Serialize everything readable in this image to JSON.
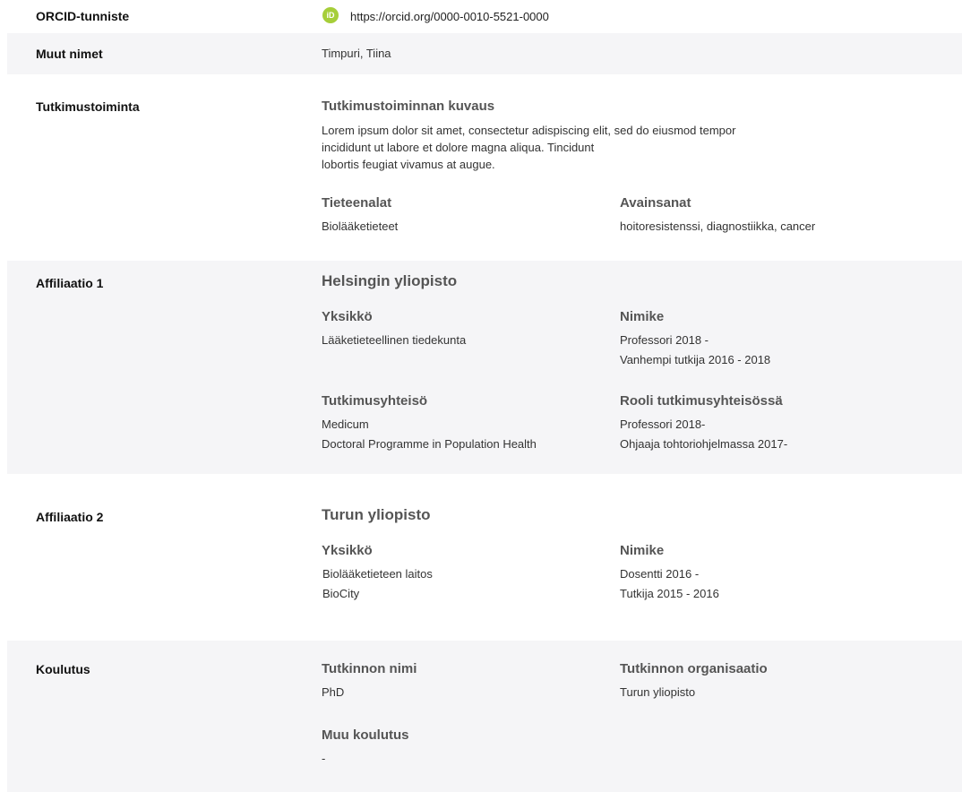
{
  "orcid": {
    "label": "ORCID-tunniste",
    "icon": "orcid-icon",
    "icon_text": "iD",
    "url": "https://orcid.org/0000-0010-5521-0000"
  },
  "other_names": {
    "label": "Muut nimet",
    "value": "Timpuri, Tiina"
  },
  "research": {
    "label": "Tutkimustoiminta",
    "desc_heading": "Tutkimustoiminnan kuvaus",
    "desc_lines": [
      "Lorem ipsum dolor sit amet, consectetur adispiscing elit, sed do eiusmod tempor",
      "incididunt ut labore et dolore magna aliqua. Tincidunt",
      "lobortis feugiat vivamus at augue."
    ],
    "fields_heading": "Tieteenalat",
    "fields_value": "Biolääketieteet",
    "keywords_heading": "Avainsanat",
    "keywords_value": "hoitoresistenssi, diagnostiikka, cancer"
  },
  "affiliation1": {
    "label": "Affiliaatio 1",
    "org": "Helsingin yliopisto",
    "unit_heading": "Yksikkö",
    "unit_value": "Lääketieteellinen tiedekunta",
    "title_heading": "Nimike",
    "title_values": [
      "Professori 2018 -",
      "Vanhempi tutkija 2016 - 2018"
    ],
    "community_heading": "Tutkimusyhteisö",
    "community_values": [
      "Medicum",
      "Doctoral Programme in Population Health"
    ],
    "role_heading": "Rooli tutkimusyhteisössä",
    "role_values": [
      "Professori 2018-",
      "Ohjaaja tohtoriohjelmassa 2017-"
    ]
  },
  "affiliation2": {
    "label": "Affiliaatio 2",
    "org": "Turun yliopisto",
    "unit_heading": "Yksikkö",
    "unit_values": [
      "Biolääketieteen laitos",
      "BioCity"
    ],
    "title_heading": "Nimike",
    "title_values": [
      "Dosentti 2016 -",
      "Tutkija 2015 - 2016"
    ]
  },
  "education": {
    "label": "Koulutus",
    "degree_heading": "Tutkinnon nimi",
    "degree_value": "PhD",
    "org_heading": "Tutkinnon organisaatio",
    "org_value": "Turun yliopisto",
    "other_heading": "Muu koulutus",
    "other_value": "-"
  }
}
